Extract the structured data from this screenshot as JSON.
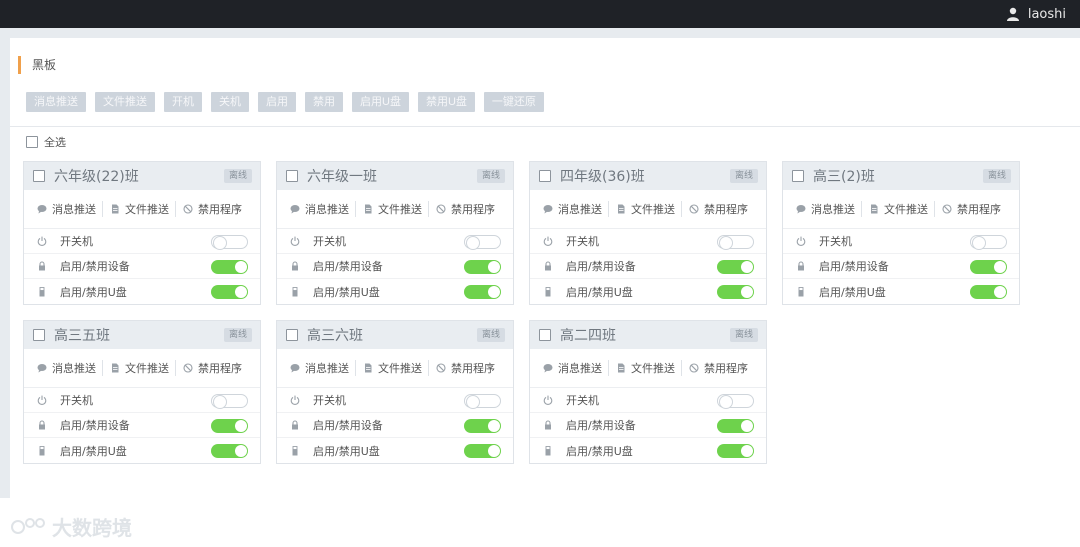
{
  "header": {
    "username": "laoshi",
    "user_icon": "user-icon"
  },
  "section": {
    "title": "黑板"
  },
  "toolbar": [
    {
      "label": "消息推送"
    },
    {
      "label": "文件推送"
    },
    {
      "label": "开机"
    },
    {
      "label": "关机"
    },
    {
      "label": "启用"
    },
    {
      "label": "禁用"
    },
    {
      "label": "启用U盘"
    },
    {
      "label": "禁用U盘"
    },
    {
      "label": "一键还原"
    }
  ],
  "select_all": {
    "label": "全选"
  },
  "card_labels": {
    "status": "离线",
    "msg": "消息推送",
    "file": "文件推送",
    "ban": "禁用程序",
    "power": "开关机",
    "device": "启用/禁用设备",
    "usb": "启用/禁用U盘"
  },
  "classes": [
    {
      "name": "六年级(22)班",
      "power_on": false,
      "device_on": true,
      "usb_on": true
    },
    {
      "name": "六年级一班",
      "power_on": false,
      "device_on": true,
      "usb_on": true
    },
    {
      "name": "四年级(36)班",
      "power_on": false,
      "device_on": true,
      "usb_on": true
    },
    {
      "name": "高三(2)班",
      "power_on": false,
      "device_on": true,
      "usb_on": true
    },
    {
      "name": "高三五班",
      "power_on": false,
      "device_on": true,
      "usb_on": true
    },
    {
      "name": "高三六班",
      "power_on": false,
      "device_on": true,
      "usb_on": true
    },
    {
      "name": "高二四班",
      "power_on": false,
      "device_on": true,
      "usb_on": true
    }
  ],
  "watermark": {
    "text": "大数跨境"
  },
  "colors": {
    "accent": "#f0a04b",
    "toggle_on": "#6ed24c",
    "topbar": "#1f2227"
  }
}
